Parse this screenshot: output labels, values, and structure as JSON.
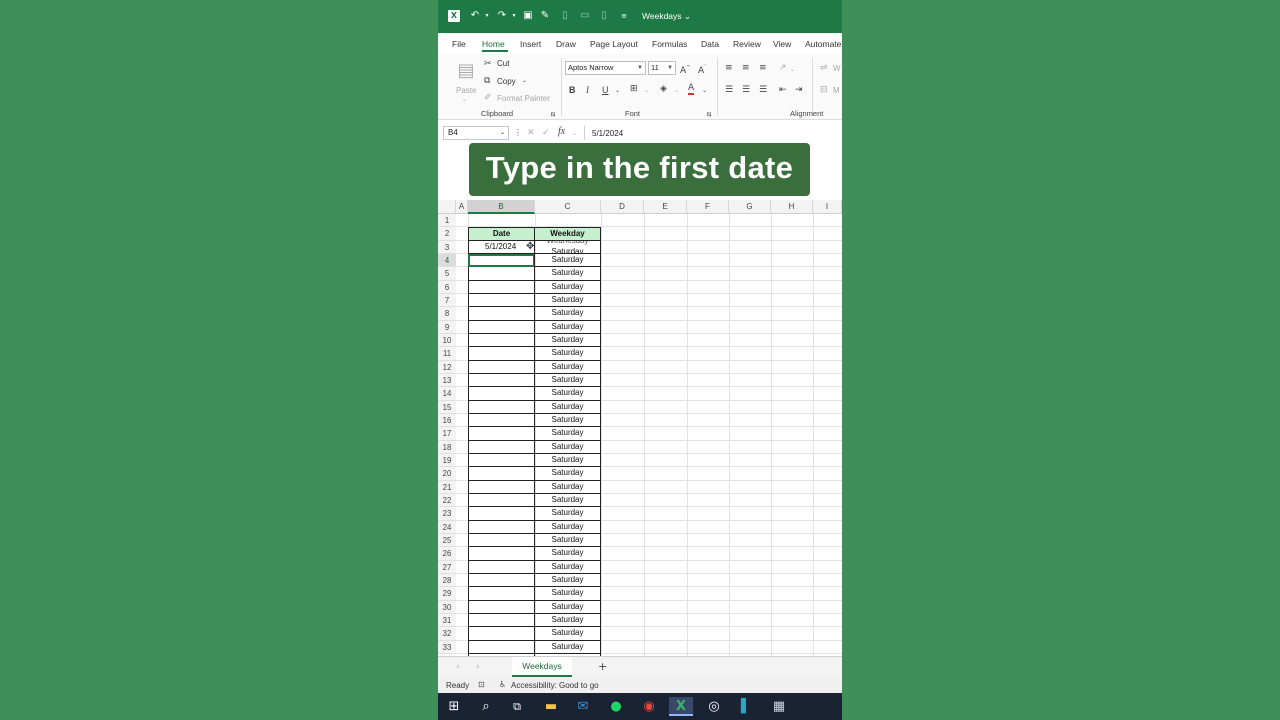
{
  "titlebar": {
    "document_title": "Weekdays",
    "icons": [
      "excel-logo-icon",
      "undo-icon",
      "redo-icon",
      "save-icon",
      "edit-icon",
      "new-icon",
      "open-icon",
      "file-icon",
      "customize-icon"
    ]
  },
  "ribbon_tabs": [
    "File",
    "Home",
    "Insert",
    "Draw",
    "Page Layout",
    "Formulas",
    "Data",
    "Review",
    "View",
    "Automate"
  ],
  "active_tab": "Home",
  "clipboard": {
    "paste": "Paste",
    "cut": "Cut",
    "copy": "Copy",
    "format_painter": "Format Painter",
    "group_label": "Clipboard"
  },
  "font": {
    "name": "Aptos Narrow",
    "size": "11",
    "bold": "B",
    "italic": "I",
    "underline": "U",
    "group_label": "Font"
  },
  "alignment": {
    "group_label": "Alignment",
    "wrap_partial": "W",
    "merge_partial": "M"
  },
  "formula_bar": {
    "name_box": "B4",
    "fx": "fx",
    "value": "5/1/2024"
  },
  "caption": "Type in the first date",
  "columns": [
    "A",
    "B",
    "C",
    "D",
    "E",
    "F",
    "G",
    "H",
    "I"
  ],
  "selected_column": "B",
  "rows": [
    "1",
    "2",
    "3",
    "4",
    "5",
    "6",
    "7",
    "8",
    "9",
    "10",
    "11",
    "12",
    "13",
    "14",
    "15",
    "16",
    "17",
    "18",
    "19",
    "20",
    "21",
    "22",
    "23",
    "24",
    "25",
    "26",
    "27",
    "28",
    "29",
    "30",
    "31",
    "32",
    "33"
  ],
  "selected_row": "4",
  "table": {
    "header_date": "Date",
    "header_weekday": "Weekday",
    "b3": "5/1/2024",
    "c3_ghost": "Wednesday",
    "c3": "Saturday",
    "weekday_fill": "Saturday"
  },
  "sheet_tabs": {
    "active": "Weekdays",
    "add": "+"
  },
  "status": {
    "ready": "Ready",
    "accessibility": "Accessibility: Good to go"
  },
  "taskbar_icons": [
    "windows-start-icon",
    "search-icon",
    "task-view-icon",
    "file-explorer-icon",
    "mail-icon",
    "spotify-icon",
    "chrome-icon",
    "excel-icon",
    "obs-icon",
    "app-icon",
    "calculator-icon"
  ],
  "colors": {
    "background": "#3e9058",
    "excel_green": "#1d7a45",
    "header_fill": "#c6efce",
    "caption_bg": "#3b6e3d"
  }
}
